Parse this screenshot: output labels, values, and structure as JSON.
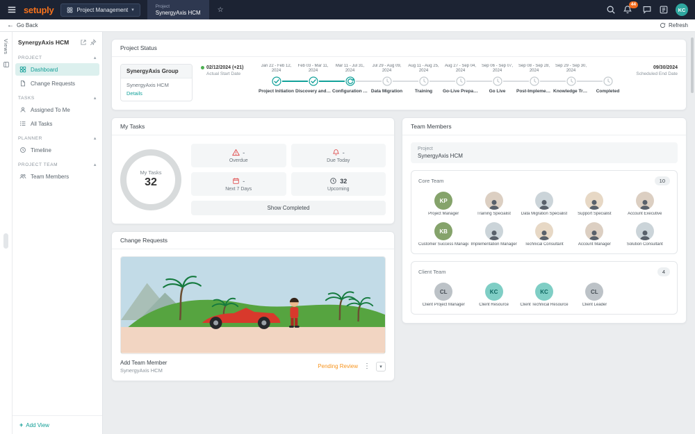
{
  "icons": {
    "star": "☆",
    "caret_down": "▾",
    "caret_up": "▴",
    "back_arrow": "←",
    "kebab": "⋮",
    "plus": "+"
  },
  "colors": {
    "accent_teal": "#12A19A",
    "brand_orange": "#F4711C",
    "alert_red": "#E04F4F",
    "pending_orange": "#F7941D",
    "topbar_navy": "#1C2333",
    "done_green": "#4CAF50"
  },
  "topbar": {
    "logo_text": "setuply",
    "nav_button_label": "Project Management",
    "tab_kicker": "Project",
    "tab_title": "SynergyAxis HCM",
    "notification_badge": "44",
    "avatar_initials": "KC"
  },
  "toolbar": {
    "back_label": "Go Back",
    "refresh_label": "Refresh"
  },
  "sidebar": {
    "views_label": "Views",
    "title": "SynergyAxis HCM",
    "sections": [
      {
        "label": "PROJECT",
        "items": [
          {
            "label": "Dashboard",
            "state": "active"
          },
          {
            "label": "Change Requests",
            "state": ""
          }
        ]
      },
      {
        "label": "TASKS",
        "items": [
          {
            "label": "Assigned To Me",
            "state": ""
          },
          {
            "label": "All Tasks",
            "state": ""
          }
        ]
      },
      {
        "label": "PLANNER",
        "items": [
          {
            "label": "Timeline",
            "state": ""
          }
        ]
      },
      {
        "label": "PROJECT TEAM",
        "items": [
          {
            "label": "Team Members",
            "state": ""
          }
        ]
      }
    ],
    "add_view_label": "Add View"
  },
  "project_status": {
    "title": "Project Status",
    "group_name": "SynergyAxis Group",
    "project_name": "SynergyAxis HCM",
    "details_label": "Details",
    "start_date": "02/12/2024 (+21)",
    "start_date_label": "Actual Start Date",
    "end_date": "09/30/2024",
    "end_date_label": "Scheduled End Date",
    "stages": [
      {
        "dates": "Jan 22 - Feb 12, 2024",
        "label": "Project Initiation",
        "state": "done"
      },
      {
        "dates": "Feb 03 - Mar 11, 2024",
        "label": "Discovery and Pla...",
        "state": "done"
      },
      {
        "dates": "Mar 11 - Jul 31, 2024",
        "label": "Configuration an...",
        "state": "active"
      },
      {
        "dates": "Jul 29 - Aug 09, 2024",
        "label": "Data Migration",
        "state": "pending"
      },
      {
        "dates": "Aug 11 - Aug 25, 2024",
        "label": "Training",
        "state": "pending"
      },
      {
        "dates": "Aug 27 - Sep 04, 2024",
        "label": "Go-Live Preparati...",
        "state": "pending"
      },
      {
        "dates": "Sep 06 - Sep 07, 2024",
        "label": "Go Live",
        "state": "pending"
      },
      {
        "dates": "Sep 08 - Sep 28, 2024",
        "label": "Post-Implementa...",
        "state": "pending"
      },
      {
        "dates": "Sep 29 - Sep 30, 2024",
        "label": "Knowledge Transf...",
        "state": "pending"
      },
      {
        "dates": "",
        "label": "Completed",
        "state": "pending"
      }
    ]
  },
  "my_tasks": {
    "title": "My Tasks",
    "ring_label": "My Tasks",
    "ring_value": "32",
    "stats": [
      {
        "label": "Overdue",
        "value": "-"
      },
      {
        "label": "Due Today",
        "value": "-"
      },
      {
        "label": "Next 7 Days",
        "value": "-"
      },
      {
        "label": "Upcoming",
        "value": "32"
      }
    ],
    "show_completed_label": "Show Completed"
  },
  "team_members": {
    "title": "Team Members",
    "project_label": "Project",
    "project_value": "SynergyAxis HCM",
    "core_team": {
      "label": "Core Team",
      "count": "10",
      "members": [
        {
          "initials": "KP",
          "label": "Project Manager",
          "variant": "green"
        },
        {
          "initials": "",
          "label": "Training Specialist",
          "variant": "photo1"
        },
        {
          "initials": "",
          "label": "Data Migration Specialist",
          "variant": "photo2"
        },
        {
          "initials": "",
          "label": "Support Specialist",
          "variant": "photo3"
        },
        {
          "initials": "",
          "label": "Account Executive",
          "variant": "photo1"
        },
        {
          "initials": "KB",
          "label": "Customer Success Manager",
          "variant": "green"
        },
        {
          "initials": "",
          "label": "Implementation Manager",
          "variant": "photo2"
        },
        {
          "initials": "",
          "label": "Technical Consultant",
          "variant": "photo3"
        },
        {
          "initials": "",
          "label": "Account Manager",
          "variant": "photo1"
        },
        {
          "initials": "",
          "label": "Solution Consultant",
          "variant": "photo2"
        }
      ]
    },
    "client_team": {
      "label": "Client Team",
      "count": "4",
      "members": [
        {
          "initials": "CL",
          "label": "Client Project Manager",
          "variant": "gray"
        },
        {
          "initials": "KC",
          "label": "Client Resource",
          "variant": "teal"
        },
        {
          "initials": "KC",
          "label": "Client Technical Resource",
          "variant": "teal"
        },
        {
          "initials": "CL",
          "label": "Client Leader",
          "variant": "gray"
        }
      ]
    }
  },
  "change_requests": {
    "title": "Change Requests",
    "item_title": "Add Team Member",
    "item_subtitle": "SynergyAxis HCM",
    "status_label": "Pending Review"
  }
}
